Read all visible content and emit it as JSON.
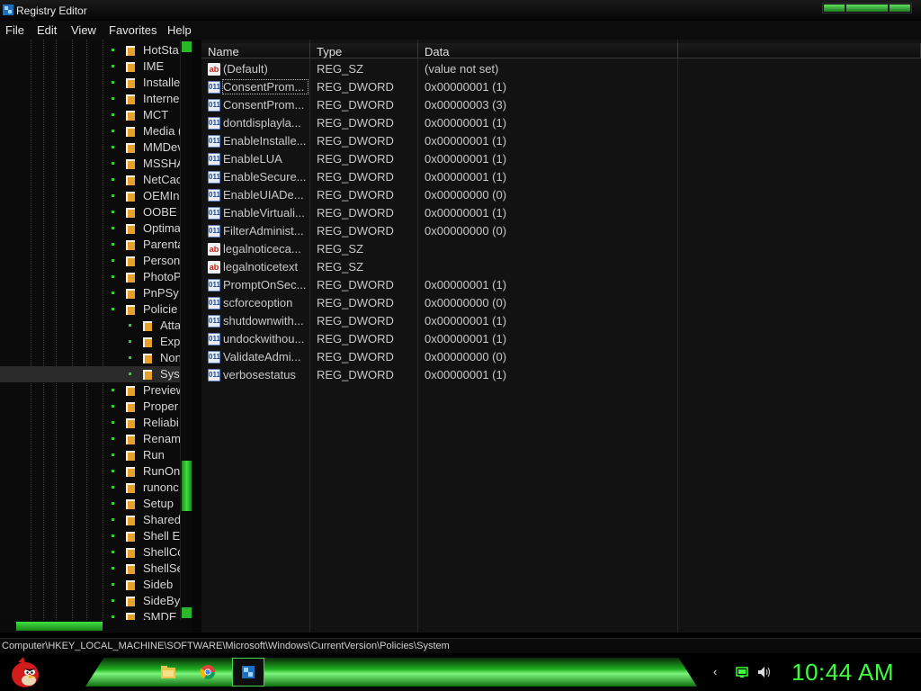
{
  "window": {
    "title": "Registry Editor"
  },
  "menu": [
    "File",
    "Edit",
    "View",
    "Favorites",
    "Help"
  ],
  "tree": [
    {
      "label": "HotSta",
      "indent": 0
    },
    {
      "label": "IME",
      "indent": 0
    },
    {
      "label": "Installe",
      "indent": 0
    },
    {
      "label": "Interne",
      "indent": 0
    },
    {
      "label": "MCT",
      "indent": 0
    },
    {
      "label": "Media (",
      "indent": 0
    },
    {
      "label": "MMDev",
      "indent": 0
    },
    {
      "label": "MSSHA",
      "indent": 0
    },
    {
      "label": "NetCac",
      "indent": 0
    },
    {
      "label": "OEMIn",
      "indent": 0
    },
    {
      "label": "OOBE",
      "indent": 0
    },
    {
      "label": "Optima",
      "indent": 0
    },
    {
      "label": "Parenta",
      "indent": 0
    },
    {
      "label": "Person",
      "indent": 0
    },
    {
      "label": "PhotoP",
      "indent": 0
    },
    {
      "label": "PnPSy",
      "indent": 0
    },
    {
      "label": "Policie",
      "indent": 0
    },
    {
      "label": "Atta",
      "indent": 1
    },
    {
      "label": "Exp",
      "indent": 1
    },
    {
      "label": "Non",
      "indent": 1
    },
    {
      "label": "Sys",
      "indent": 1
    },
    {
      "label": "Preview",
      "indent": 0
    },
    {
      "label": "Proper",
      "indent": 0
    },
    {
      "label": "Reliabi",
      "indent": 0
    },
    {
      "label": "Renam",
      "indent": 0
    },
    {
      "label": "Run",
      "indent": 0
    },
    {
      "label": "RunOn",
      "indent": 0
    },
    {
      "label": "runonc",
      "indent": 0
    },
    {
      "label": "Setup",
      "indent": 0
    },
    {
      "label": "Shared",
      "indent": 0
    },
    {
      "label": "Shell E",
      "indent": 0
    },
    {
      "label": "ShellCo",
      "indent": 0
    },
    {
      "label": "ShellSe",
      "indent": 0
    },
    {
      "label": "Sideb",
      "indent": 0
    },
    {
      "label": "SideBy",
      "indent": 0
    },
    {
      "label": "SMDE",
      "indent": 0
    }
  ],
  "columns": {
    "name": "Name",
    "type": "Type",
    "data": "Data"
  },
  "values": [
    {
      "name": "(Default)",
      "type": "REG_SZ",
      "data": "(value not set)",
      "icon": "string-value-icon"
    },
    {
      "name": "ConsentProm...",
      "type": "REG_DWORD",
      "data": "0x00000001 (1)",
      "icon": "dword-value-icon"
    },
    {
      "name": "ConsentProm...",
      "type": "REG_DWORD",
      "data": "0x00000003 (3)",
      "icon": "dword-value-icon"
    },
    {
      "name": "dontdisplayla...",
      "type": "REG_DWORD",
      "data": "0x00000001 (1)",
      "icon": "dword-value-icon"
    },
    {
      "name": "EnableInstalle...",
      "type": "REG_DWORD",
      "data": "0x00000001 (1)",
      "icon": "dword-value-icon"
    },
    {
      "name": "EnableLUA",
      "type": "REG_DWORD",
      "data": "0x00000001 (1)",
      "icon": "dword-value-icon"
    },
    {
      "name": "EnableSecure...",
      "type": "REG_DWORD",
      "data": "0x00000001 (1)",
      "icon": "dword-value-icon"
    },
    {
      "name": "EnableUIADe...",
      "type": "REG_DWORD",
      "data": "0x00000000 (0)",
      "icon": "dword-value-icon"
    },
    {
      "name": "EnableVirtuali...",
      "type": "REG_DWORD",
      "data": "0x00000001 (1)",
      "icon": "dword-value-icon"
    },
    {
      "name": "FilterAdminist...",
      "type": "REG_DWORD",
      "data": "0x00000000 (0)",
      "icon": "dword-value-icon"
    },
    {
      "name": "legalnoticeca...",
      "type": "REG_SZ",
      "data": "",
      "icon": "string-value-icon"
    },
    {
      "name": "legalnoticetext",
      "type": "REG_SZ",
      "data": "",
      "icon": "string-value-icon"
    },
    {
      "name": "PromptOnSec...",
      "type": "REG_DWORD",
      "data": "0x00000001 (1)",
      "icon": "dword-value-icon"
    },
    {
      "name": "scforceoption",
      "type": "REG_DWORD",
      "data": "0x00000000 (0)",
      "icon": "dword-value-icon"
    },
    {
      "name": "shutdownwith...",
      "type": "REG_DWORD",
      "data": "0x00000001 (1)",
      "icon": "dword-value-icon"
    },
    {
      "name": "undockwithou...",
      "type": "REG_DWORD",
      "data": "0x00000001 (1)",
      "icon": "dword-value-icon"
    },
    {
      "name": "ValidateAdmi...",
      "type": "REG_DWORD",
      "data": "0x00000000 (0)",
      "icon": "dword-value-icon"
    },
    {
      "name": "verbosestatus",
      "type": "REG_DWORD",
      "data": "0x00000001 (1)",
      "icon": "dword-value-icon"
    }
  ],
  "icon_text": {
    "string": "ab",
    "dword": "011"
  },
  "status": "Computer\\HKEY_LOCAL_MACHINE\\SOFTWARE\\Microsoft\\Windows\\CurrentVersion\\Policies\\System",
  "taskbar": {
    "start_icon": "angry-bird-start-icon",
    "buttons": [
      "file-explorer-icon",
      "chrome-icon",
      "registry-editor-icon"
    ],
    "tray": [
      "show-hidden-icons-icon",
      "network-icon",
      "volume-icon"
    ],
    "clock": "10:44 AM"
  },
  "colors": {
    "accent": "#3cff3c",
    "background": "#121212"
  }
}
